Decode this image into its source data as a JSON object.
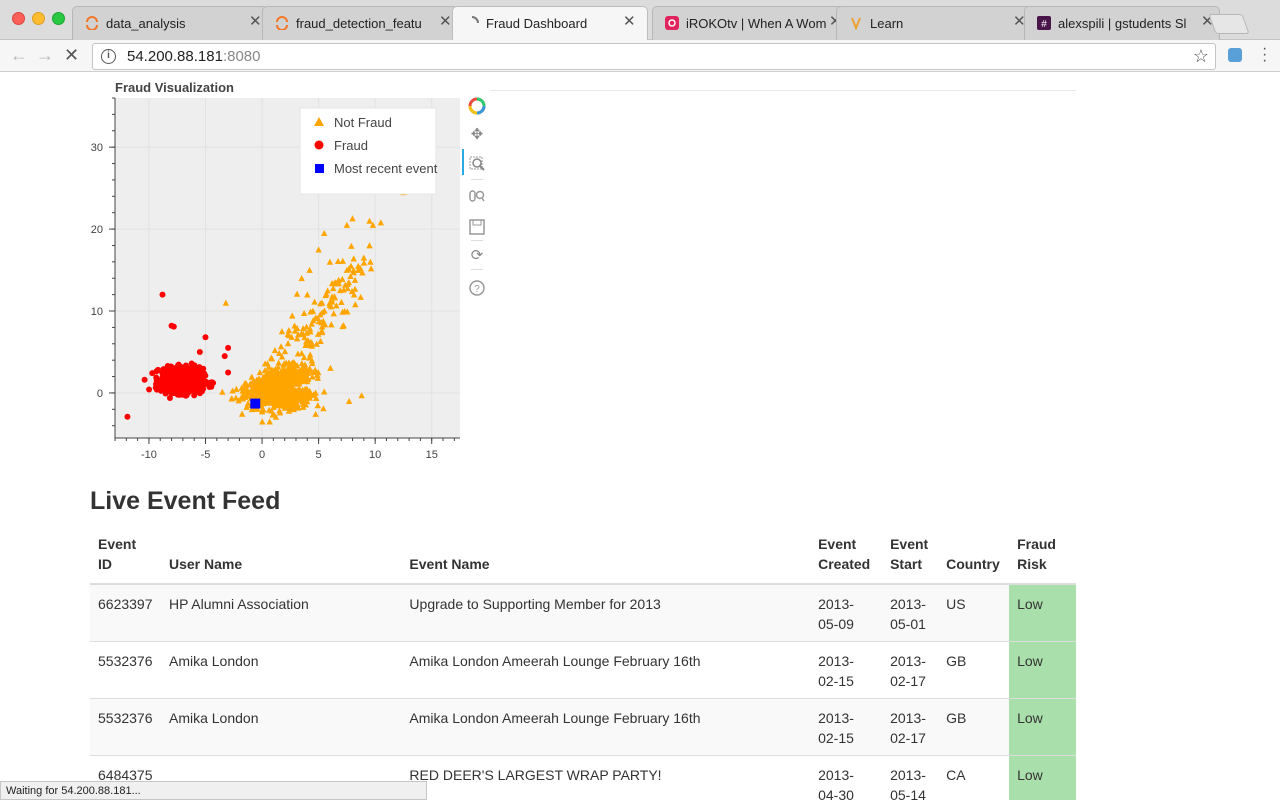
{
  "browser": {
    "tabs": [
      {
        "label": "data_analysis",
        "icon": "jupyter-icon"
      },
      {
        "label": "fraud_detection_feature",
        "icon": "jupyter-icon"
      },
      {
        "label": "Fraud Dashboard",
        "icon": "loading-spinner-icon"
      },
      {
        "label": "iROKOtv | When A Wom",
        "icon": "irokotv-icon"
      },
      {
        "label": "Learn",
        "icon": "learn-icon"
      },
      {
        "label": "alexspili | gstudents Sla",
        "icon": "slack-icon"
      }
    ],
    "url_host": "54.200.88.181",
    "url_port": ":8080",
    "status": "Waiting for 54.200.88.181..."
  },
  "plot": {
    "title": "Fraud Visualization",
    "legend": [
      "Not Fraud",
      "Fraud",
      "Most recent event"
    ],
    "colors": {
      "not_fraud": "#ffa500",
      "fraud": "#ff0000",
      "recent": "#0000ff",
      "plot_bg": "#eeeeee"
    }
  },
  "chart_data": {
    "type": "scatter",
    "title": "Fraud Visualization",
    "xlim": [
      -13,
      17.5
    ],
    "ylim": [
      -5.5,
      36
    ],
    "x_ticks": [
      -10,
      -5,
      0,
      5,
      10,
      15
    ],
    "y_ticks": [
      0,
      10,
      20,
      30
    ],
    "legend_position": "top-right",
    "grid": true,
    "series": [
      {
        "name": "Not Fraud",
        "marker": "triangle",
        "color": "#ffa500",
        "cluster": {
          "center": [
            1.5,
            0.5
          ],
          "spread": [
            2.4,
            2.0
          ],
          "count": 900
        },
        "outliers": [
          [
            12.5,
            24.5
          ],
          [
            10.5,
            20.8
          ],
          [
            9.8,
            20.5
          ],
          [
            9.5,
            21
          ],
          [
            8,
            21.3
          ],
          [
            7.5,
            20.5
          ],
          [
            5.5,
            19.5
          ],
          [
            5,
            17.5
          ],
          [
            6,
            16
          ],
          [
            4.2,
            15
          ],
          [
            3.5,
            14
          ],
          [
            4,
            12
          ],
          [
            9.5,
            18
          ],
          [
            9,
            16.5
          ],
          [
            8.5,
            15.5
          ],
          [
            7.5,
            15
          ],
          [
            6.5,
            13.5
          ],
          [
            5.8,
            12.5
          ],
          [
            -3.2,
            11
          ],
          [
            8.8,
            -0.3
          ],
          [
            7.7,
            -1
          ],
          [
            5.5,
            8.5
          ],
          [
            4.5,
            10
          ]
        ]
      },
      {
        "name": "Fraud",
        "marker": "circle",
        "color": "#ff0000",
        "cluster": {
          "center": [
            -7.0,
            1.5
          ],
          "spread": [
            1.5,
            1.2
          ],
          "count": 700
        },
        "outliers": [
          [
            -8.8,
            12
          ],
          [
            -8,
            8.2
          ],
          [
            -7.8,
            8.1
          ],
          [
            -5,
            6.8
          ],
          [
            -5.5,
            5
          ],
          [
            -3,
            5.5
          ],
          [
            -3.3,
            4.5
          ],
          [
            -11.9,
            -2.9
          ],
          [
            -3,
            2.5
          ]
        ]
      },
      {
        "name": "Most recent event",
        "marker": "square",
        "color": "#0000ff",
        "points": [
          [
            -0.6,
            -1.3
          ]
        ]
      }
    ]
  },
  "feed": {
    "title": "Live Event Feed",
    "columns": [
      "Event ID",
      "User Name",
      "Event Name",
      "Event Created",
      "Event Start",
      "Country",
      "Fraud Risk"
    ],
    "rows": [
      {
        "event_id": "6623397",
        "user_name": "HP Alumni Association",
        "event_name": "Upgrade to Supporting Member for 2013",
        "created": "2013-05-09",
        "start": "2013-05-01",
        "country": "US",
        "risk": "Low"
      },
      {
        "event_id": "5532376",
        "user_name": "Amika London",
        "event_name": "Amika London Ameerah Lounge February 16th",
        "created": "2013-02-15",
        "start": "2013-02-17",
        "country": "GB",
        "risk": "Low"
      },
      {
        "event_id": "5532376",
        "user_name": "Amika London",
        "event_name": "Amika London Ameerah Lounge February 16th",
        "created": "2013-02-15",
        "start": "2013-02-17",
        "country": "GB",
        "risk": "Low"
      },
      {
        "event_id": "6484375",
        "user_name": "",
        "event_name": "RED DEER'S LARGEST WRAP PARTY!",
        "created": "2013-04-30",
        "start": "2013-05-14",
        "country": "CA",
        "risk": "Low"
      }
    ],
    "risk_color_low": "#a9dfaa"
  }
}
